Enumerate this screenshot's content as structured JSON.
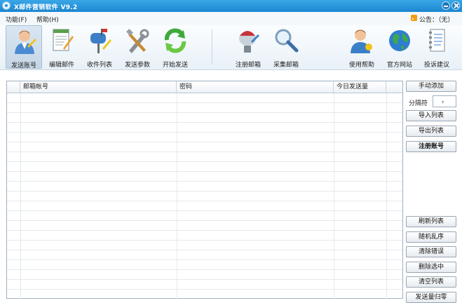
{
  "window": {
    "title": "X邮件营销软件    V9.2"
  },
  "menu": {
    "items": [
      "功能(F)",
      "帮助(H)"
    ],
    "announcement": "公告：（无）"
  },
  "toolbar": {
    "groups": [
      [
        {
          "label": "发送账号",
          "icon": "user-icon",
          "active": true
        },
        {
          "label": "编辑邮件",
          "icon": "edit-document-icon"
        },
        {
          "label": "收件列表",
          "icon": "mailbox-icon"
        },
        {
          "label": "发送参数",
          "icon": "tools-icon"
        },
        {
          "label": "开始发送",
          "icon": "refresh-arrows-icon"
        }
      ],
      [
        {
          "label": "注册邮箱",
          "icon": "register-mailbox-icon"
        },
        {
          "label": "采集邮箱",
          "icon": "magnifier-icon"
        }
      ],
      [
        {
          "label": "使用帮助",
          "icon": "help-person-icon"
        },
        {
          "label": "官方网站",
          "icon": "globe-icon"
        },
        {
          "label": "投诉建议",
          "icon": "notebook-icon"
        }
      ]
    ]
  },
  "grid": {
    "columns": [
      "",
      "邮箱帐号",
      "密码",
      "今日发送量"
    ],
    "rows": []
  },
  "side": {
    "manual_add": "手动添加",
    "separator_label": "分隔符",
    "separator_value": "，",
    "import_list": "导入列表",
    "export_list": "导出列表",
    "register_account": "注册账号",
    "refresh_list": "刷新列表",
    "shuffle": "随机乱序",
    "clear_errors": "清除错误",
    "delete_selected": "删除选中",
    "clear_list": "清空列表",
    "reset_sent": "发送量归零"
  }
}
